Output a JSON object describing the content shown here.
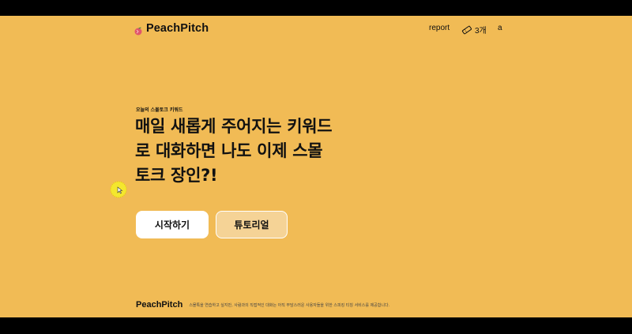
{
  "header": {
    "logo_text": "PeachPitch",
    "nav": {
      "report_label": "report",
      "ticket_count": "3개",
      "user_label": "a"
    }
  },
  "hero": {
    "kicker": "오늘의 스몰토크 키워드",
    "headline_lines": [
      "매일 새롭게 주어지는 키워드",
      "로 대화하면 나도 이제 스몰",
      "토크 장인?!"
    ],
    "start_button": "시작하기",
    "tutorial_button": "튜토리얼"
  },
  "footer": {
    "logo_text": "PeachPitch",
    "description": "스몰톡을 연습하고 싶지만, 사람과의 직접적인 대화는 아직 부담스러운 사용자들을 위한 스피킹 티칭 서비스를 제공합니다."
  },
  "colors": {
    "background": "#f1bb55",
    "primary_button": "#ffffff",
    "secondary_button": "#f5d396",
    "text": "#111111"
  },
  "icons": {
    "logo": "peach-icon",
    "ticket": "ticket-icon",
    "cursor": "click-indicator-icon"
  }
}
